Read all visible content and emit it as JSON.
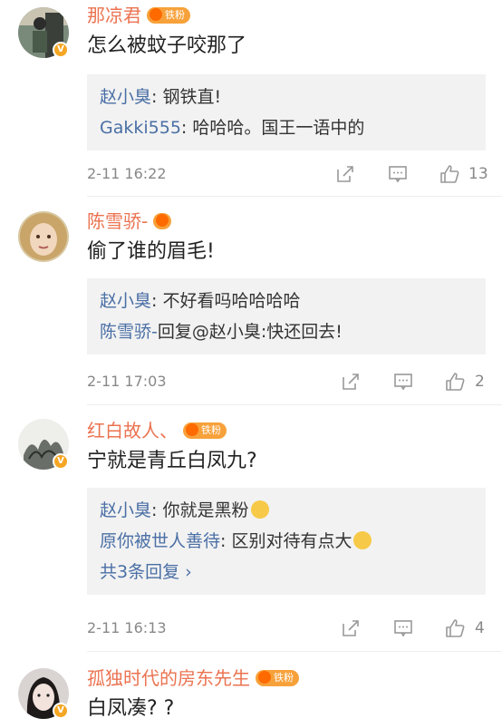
{
  "comments": [
    {
      "username": "那凉君",
      "fan_badge": "铁粉",
      "content": "怎么被蚊子咬那了",
      "replies": [
        {
          "name": "赵小臭",
          "text": ": 钢铁直!"
        },
        {
          "name": "Gakki555",
          "text": ": 哈哈哈。国王一语中的"
        }
      ],
      "time": "2-11 16:22",
      "likes": "13"
    },
    {
      "username": "陈雪骄-",
      "content": "偷了谁的眉毛!",
      "replies": [
        {
          "name": "赵小臭",
          "text": ": 不好看吗哈哈哈哈"
        },
        {
          "name": "陈雪骄-",
          "text": "回复@赵小臭:快还回去!"
        }
      ],
      "time": "2-11 17:03",
      "likes": "2"
    },
    {
      "username": "红白故人、",
      "fan_badge": "铁粉",
      "content": "宁就是青丘白凤九?",
      "replies": [
        {
          "name": "赵小臭",
          "text": ": 你就是黑粉"
        },
        {
          "name": "原你被世人善待",
          "text": ": 区别对待有点大"
        }
      ],
      "more_replies": "共3条回复 ›",
      "time": "2-11 16:13",
      "likes": "4"
    },
    {
      "username": "孤独时代的房东先生",
      "fan_badge": "铁粉",
      "content": "白凤凑? ?"
    }
  ],
  "icons": {
    "share": "share-icon",
    "comment": "comment-icon",
    "like": "thumbs-up-icon",
    "verified": "verified-badge-icon"
  },
  "colors": {
    "username": "#eb7350",
    "reply_name": "#4a6fa5",
    "badge": "#f7a13a",
    "reply_bg": "#f2f2f2",
    "meta": "#888888"
  }
}
